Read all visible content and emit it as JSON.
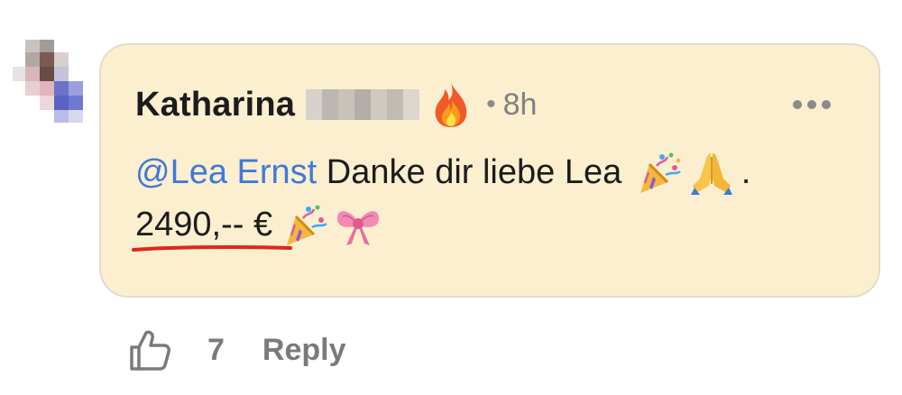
{
  "comment": {
    "author_first_name": "Katharina",
    "author_last_name_obscured": true,
    "author_badge_icon": "fire-icon",
    "separator": "•",
    "time_ago": "8h",
    "more_icon": "more-horizontal-icon",
    "mention": "@Lea Ernst",
    "message_text": " Danke dir liebe Lea ",
    "message_emojis": [
      "party-popper-icon",
      "folded-hands-icon"
    ],
    "message_end": ".",
    "price": "2490,-- €",
    "price_emojis": [
      "party-popper-icon",
      "ribbon-bow-icon"
    ],
    "price_underline_color": "#e0261b"
  },
  "actions": {
    "like_icon": "thumbs-up-icon",
    "like_count": "7",
    "reply_label": "Reply"
  },
  "colors": {
    "bubble_bg": "#fbefcf",
    "mention": "#3f7ad9",
    "muted": "#7a7a7a"
  }
}
